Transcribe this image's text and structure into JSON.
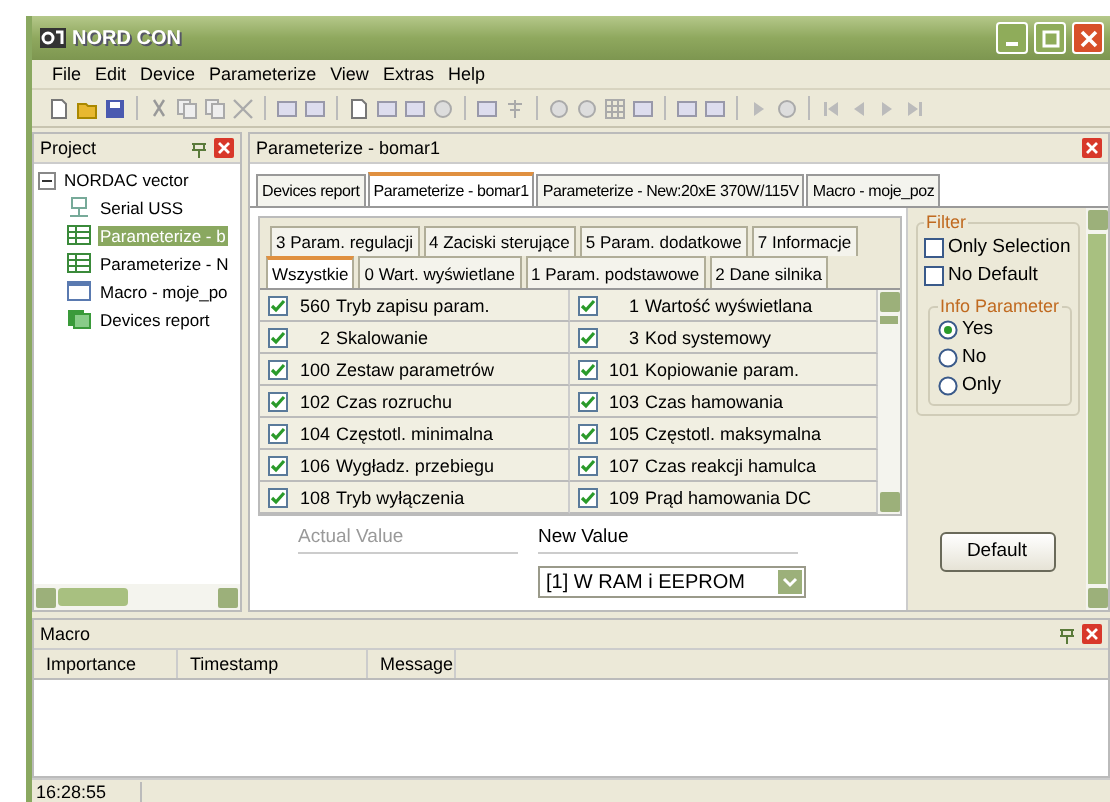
{
  "window": {
    "title": "NORD CON"
  },
  "menu": [
    "File",
    "Edit",
    "Device",
    "Parameterize",
    "View",
    "Extras",
    "Help"
  ],
  "project": {
    "title": "Project",
    "tree": [
      {
        "label": "NORDAC vector",
        "expanded": true,
        "children": [
          {
            "label": "Serial USS",
            "kind": "serial",
            "selected": false
          },
          {
            "label": "Parameterize - b",
            "kind": "param",
            "selected": true
          },
          {
            "label": "Parameterize - N",
            "kind": "param",
            "selected": false
          },
          {
            "label": "Macro - moje_po",
            "kind": "macro",
            "selected": false
          },
          {
            "label": "Devices report",
            "kind": "report",
            "selected": false
          }
        ]
      }
    ]
  },
  "document": {
    "title": "Parameterize - bomar1",
    "tabs": [
      {
        "label": "Devices report",
        "selected": false
      },
      {
        "label": "Parameterize - bomar1",
        "selected": true
      },
      {
        "label": "Parameterize - New:20xE 370W/115V",
        "selected": false
      },
      {
        "label": "Macro - moje_poz",
        "selected": false
      }
    ],
    "param_tab_rows": [
      [
        {
          "label": "3 Param. regulacji",
          "selected": false
        },
        {
          "label": "4 Zaciski sterujące",
          "selected": false
        },
        {
          "label": "5 Param. dodatkowe",
          "selected": false
        },
        {
          "label": "7 Informacje",
          "selected": false
        }
      ],
      [
        {
          "label": "Wszystkie",
          "selected": true
        },
        {
          "label": "0 Wart. wyświetlane",
          "selected": false
        },
        {
          "label": "1 Param. podstawowe",
          "selected": false
        },
        {
          "label": "2 Dane silnika",
          "selected": false
        }
      ]
    ],
    "parameters": [
      {
        "checked": true,
        "number": "560",
        "name": "Tryb zapisu param."
      },
      {
        "checked": true,
        "number": "1",
        "name": "Wartość wyświetlana"
      },
      {
        "checked": true,
        "number": "2",
        "name": "Skalowanie"
      },
      {
        "checked": true,
        "number": "3",
        "name": "Kod systemowy"
      },
      {
        "checked": true,
        "number": "100",
        "name": "Zestaw parametrów"
      },
      {
        "checked": true,
        "number": "101",
        "name": "Kopiowanie param."
      },
      {
        "checked": true,
        "number": "102",
        "name": "Czas rozruchu"
      },
      {
        "checked": true,
        "number": "103",
        "name": "Czas hamowania"
      },
      {
        "checked": true,
        "number": "104",
        "name": "Częstotl. minimalna"
      },
      {
        "checked": true,
        "number": "105",
        "name": "Częstotl. maksymalna"
      },
      {
        "checked": true,
        "number": "106",
        "name": "Wygładz. przebiegu"
      },
      {
        "checked": true,
        "number": "107",
        "name": "Czas reakcji hamulca"
      },
      {
        "checked": true,
        "number": "108",
        "name": "Tryb wyłączenia"
      },
      {
        "checked": true,
        "number": "109",
        "name": "Prąd hamowania DC"
      }
    ],
    "value_editor": {
      "actual_label": "Actual Value",
      "new_label": "New Value",
      "new_value": "[1] W RAM i EEPROM"
    },
    "filter": {
      "title": "Filter",
      "options": [
        {
          "label": "Only Selection",
          "checked": false
        },
        {
          "label": "No Default",
          "checked": false
        }
      ],
      "info": {
        "title": "Info Parameter",
        "options": [
          {
            "label": "Yes",
            "selected": true
          },
          {
            "label": "No",
            "selected": false
          },
          {
            "label": "Only",
            "selected": false
          }
        ]
      },
      "button": "Default"
    }
  },
  "macro": {
    "title": "Macro",
    "columns": [
      "Importance",
      "Timestamp",
      "Message"
    ]
  },
  "status_bar": {
    "time": "16:28:55"
  }
}
